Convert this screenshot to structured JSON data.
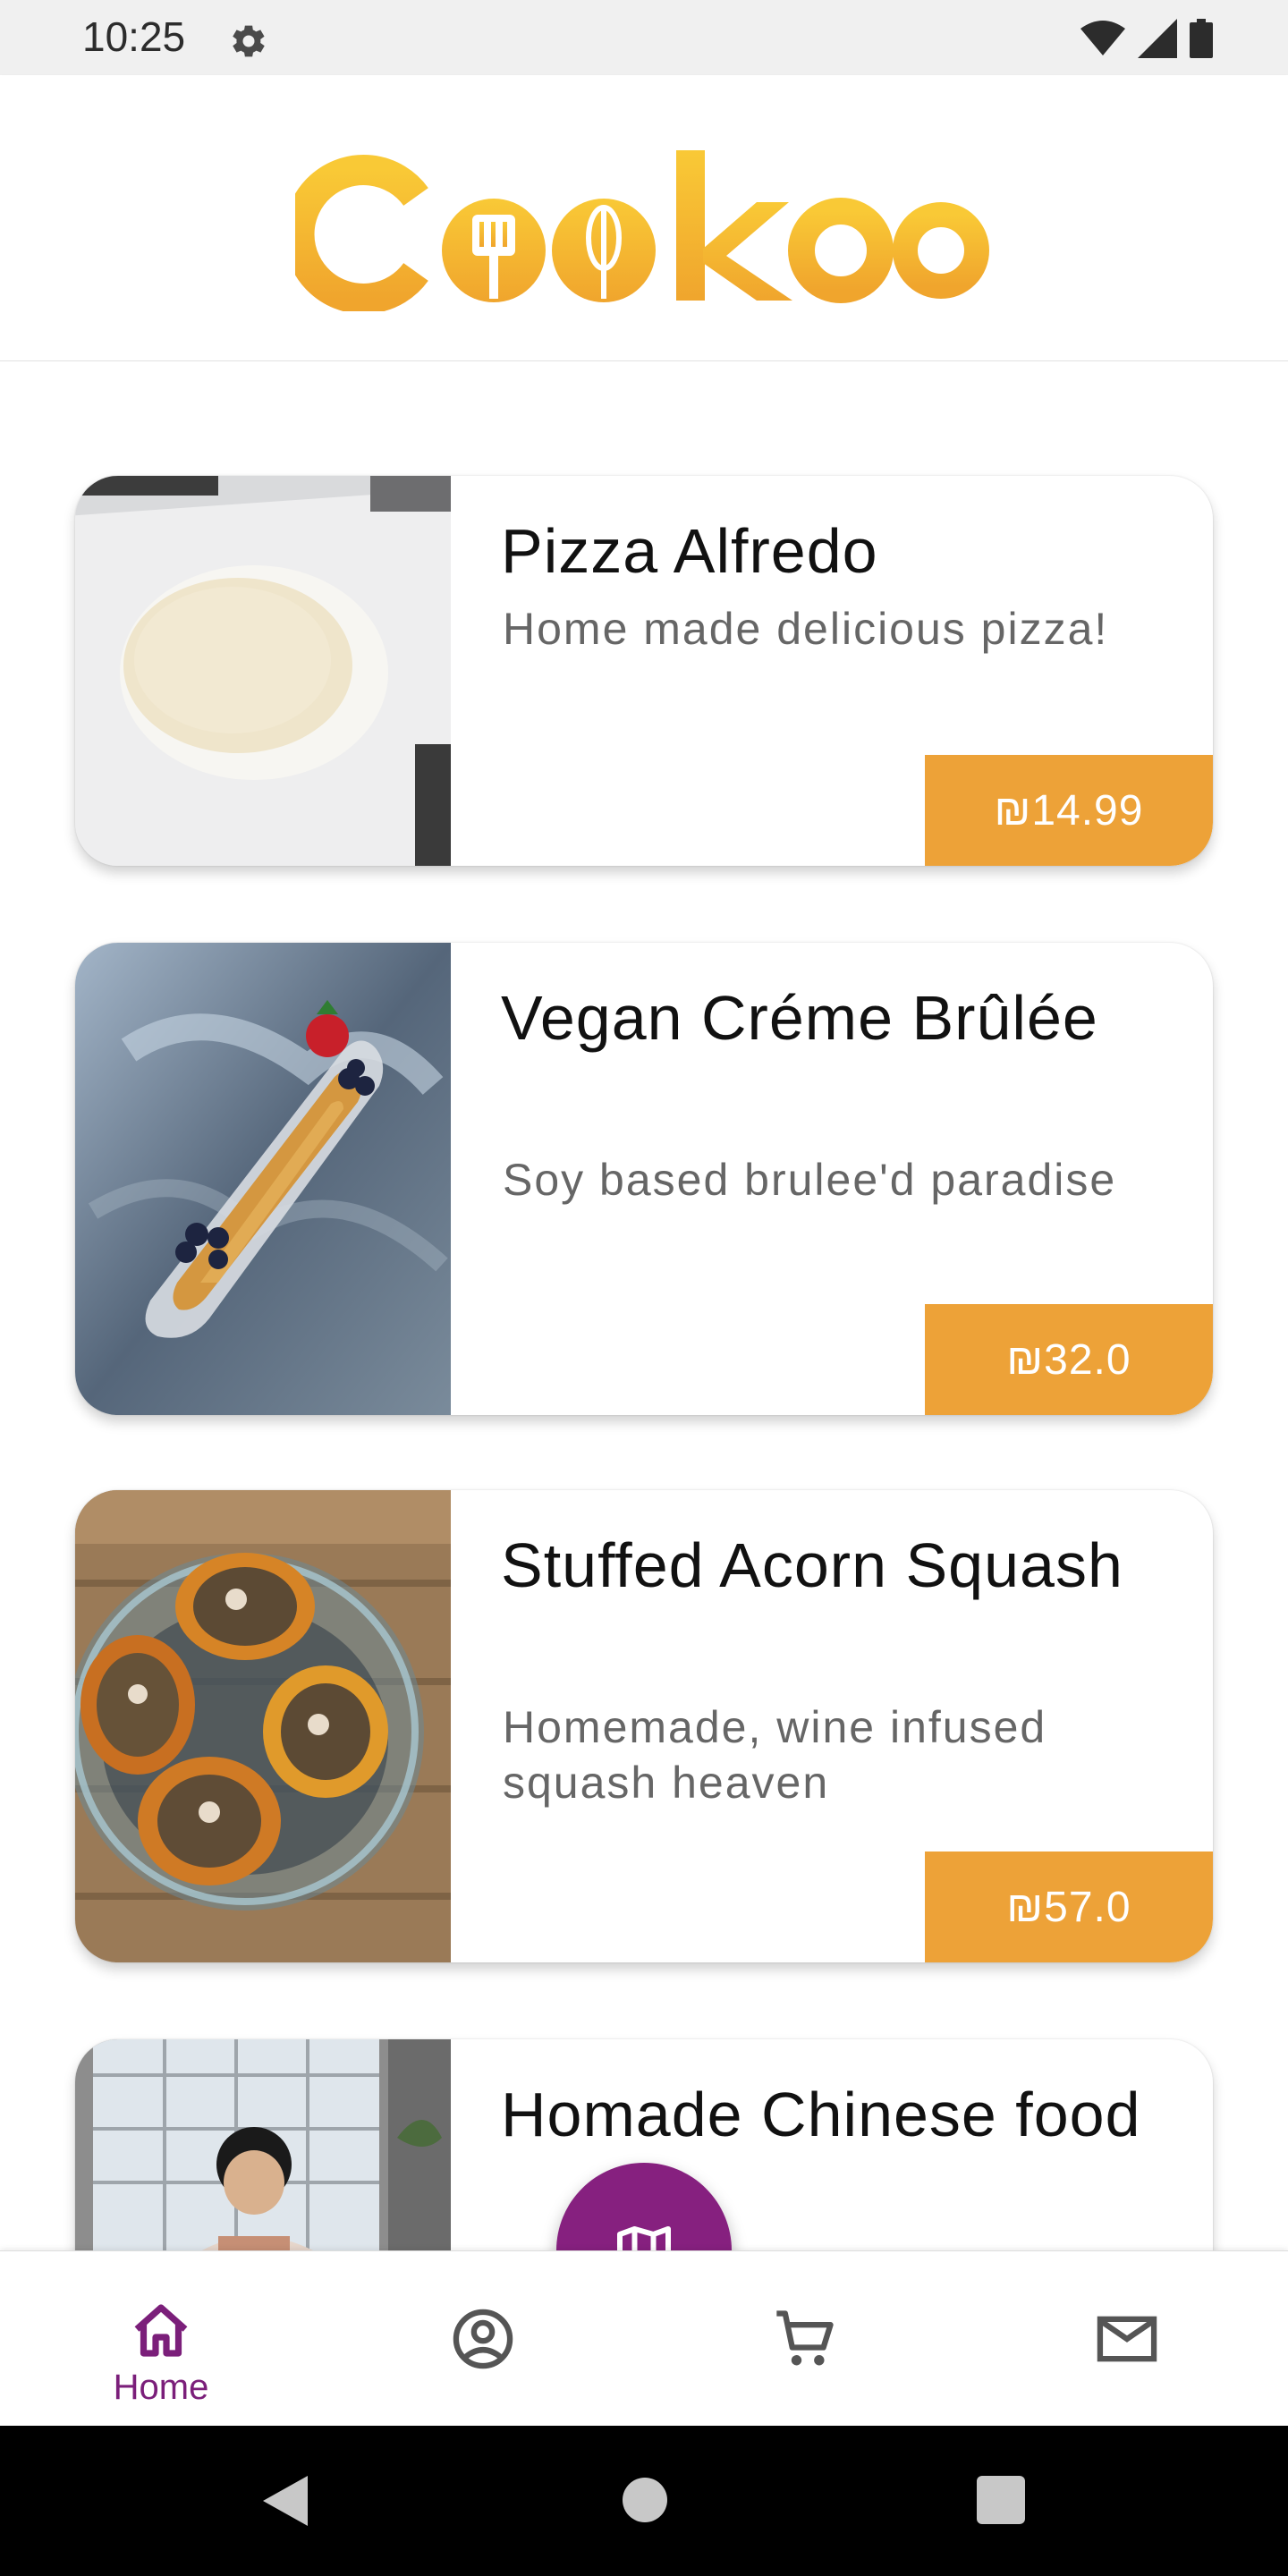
{
  "status_bar": {
    "time": "10:25",
    "settings_icon": "gear-icon",
    "wifi_icon": "wifi-icon",
    "signal_icon": "cellular-signal-icon",
    "battery_icon": "battery-icon"
  },
  "header": {
    "logo_text": "Cookoo"
  },
  "recipes": [
    {
      "title": "Pizza Alfredo",
      "description": "Home made delicious pizza!",
      "price": "₪14.99"
    },
    {
      "title": "Vegan Créme Brûlée",
      "description": "Soy based brulee'd paradise",
      "price": "₪32.0"
    },
    {
      "title": "Stuffed Acorn Squash",
      "description": "Homemade, wine infused squash heaven",
      "price": "₪57.0"
    },
    {
      "title": "Homade Chinese food",
      "description": "",
      "price": ""
    }
  ],
  "bottom_nav": {
    "items": [
      {
        "label": "Home",
        "icon": "home-icon",
        "selected": true
      },
      {
        "label": "",
        "icon": "profile-icon",
        "selected": false
      },
      {
        "label": "",
        "icon": "cart-icon",
        "selected": false
      },
      {
        "label": "",
        "icon": "mail-icon",
        "selected": false
      }
    ],
    "fab_icon": "map-icon"
  },
  "system_nav": {
    "back_icon": "back-triangle-icon",
    "home_icon": "home-circle-icon",
    "recents_icon": "recents-square-icon"
  },
  "colors": {
    "accent_orange": "#eda238",
    "logo_yellow": "#f6b72a",
    "primary_purple": "#86207f",
    "nav_text_purple": "#7b1f7a"
  }
}
